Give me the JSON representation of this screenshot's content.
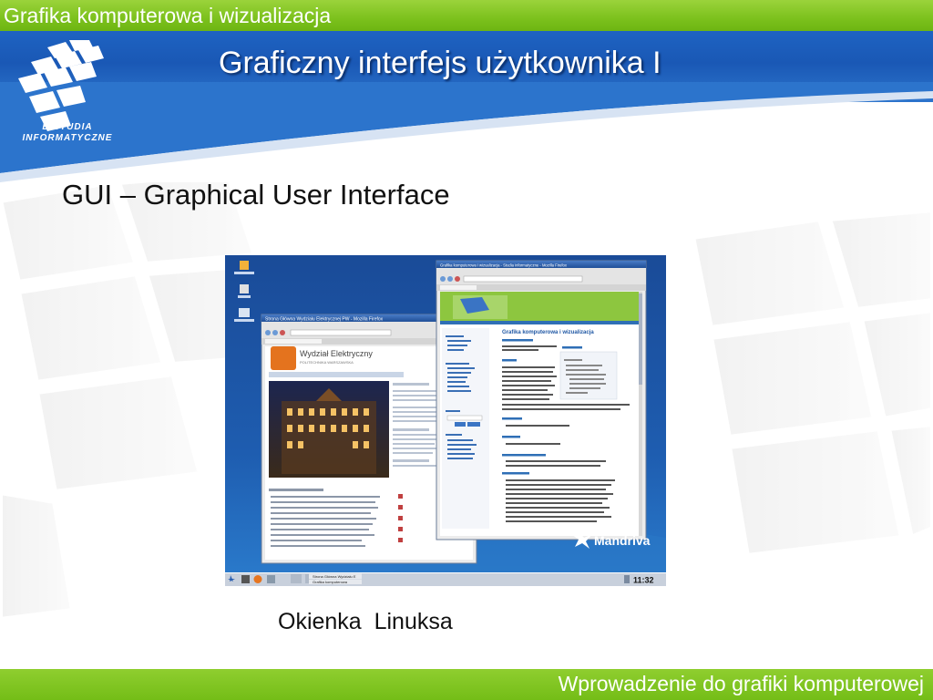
{
  "header": {
    "course_title": "Grafika komputerowa i wizualizacja"
  },
  "logo": {
    "line1": "E-STUDIA",
    "line2": "INFORMATYCZNE"
  },
  "slide": {
    "title": "Graficzny interfejs użytkownika I",
    "heading": "GUI – Graphical User Interface",
    "caption": "Okienka  Linuksa"
  },
  "footer": {
    "text": "Wprowadzenie do grafiki komputerowej"
  },
  "screenshot": {
    "left_window_title": "Strona Główna Wydziału Elektrycznej PW - Mozilla Firefox",
    "left_logo_text": "Wydział Elektryczny",
    "left_logo_sub": "POLITECHNIKA WARSZAWSKA",
    "right_window_title": "Grafika komputerowa i wizualizacja - Studia informatyczne - Mozilla Firefox",
    "right_page_heading": "Grafika komputerowa i wizualizacja",
    "distro_brand": "Mandriva",
    "clock": "11:32",
    "task1": "Strona Główna Wydziału E",
    "task2": "Grafika komputerowa"
  },
  "colors": {
    "green_bar": "#7cc11d",
    "blue_band": "#1a58b5",
    "desktop_blue": "#1d4f9e"
  }
}
